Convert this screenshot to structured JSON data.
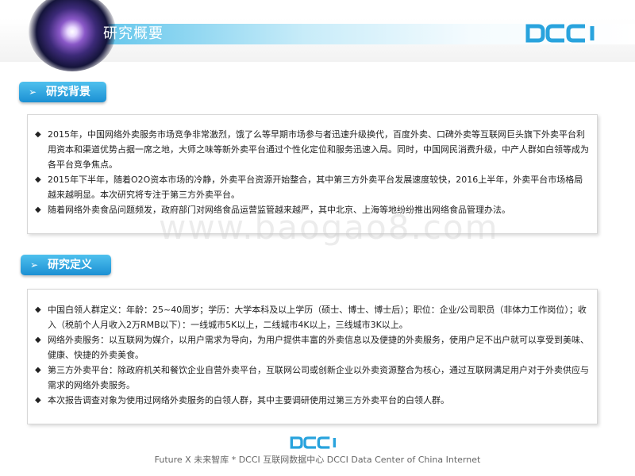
{
  "header": {
    "title": "研究概要",
    "logo_text": "DCCI"
  },
  "sections": [
    {
      "label": "研究背景",
      "bullets": [
        "2015年，中国网络外卖服务市场竞争非常激烈，饿了么等早期市场参与者迅速升级换代，百度外卖、口碑外卖等互联网巨头旗下外卖平台利用资本和渠道优势占据一席之地，大师之味等新外卖平台通过个性化定位和服务迅速入局。同时，中国网民消费升级，中产人群如白领等成为各平台竞争焦点。",
        "2015年下半年，随着O2O资本市场的冷静，外卖平台资源开始整合，其中第三方外卖平台发展速度较快，2016上半年，外卖平台市场格局越来越明显。本次研究将专注于第三方外卖平台。",
        "随着网络外卖食品问题频发，政府部门对网络食品运营监管越来越严，其中北京、上海等地纷纷推出网络食品管理办法。"
      ]
    },
    {
      "label": "研究定义",
      "bullets": [
        "中国白领人群定义：年龄：25~40周岁；学历：大学本科及以上学历（硕士、博士、博士后）；职位：企业/公司职员（非体力工作岗位）；收入（税前个人月收入2万RMB以下）：一线城市5K以上，二线城市4K以上，三线城市3K以上。",
        "网络外卖服务：以互联网为媒介，以用户需求为导向，为用户提供丰富的外卖信息以及便捷的外卖服务，使用户足不出户就可以享受到美味、健康、快捷的外卖美食。",
        "第三方外卖平台：除政府机关和餐饮企业自营外卖平台，互联网公司或创新企业以外卖资源整合为核心，通过互联网满足用户对于外卖供应与需求的网络外卖服务。",
        "本次报告调查对象为使用过网络外卖服务的白领人群，其中主要调研使用过第三方外卖平台的白领人群。"
      ]
    }
  ],
  "watermark": "www.baogao8.com",
  "footer": {
    "logo_text": "DCCI",
    "text": "Future X 未来智库 * DCCI 互联网数据中心 DCCI Data Center of China Internet"
  },
  "colors": {
    "accent": "#1b8fd3",
    "title_bar": "#5cc3ea",
    "logo_blue": "#29a3dd"
  }
}
